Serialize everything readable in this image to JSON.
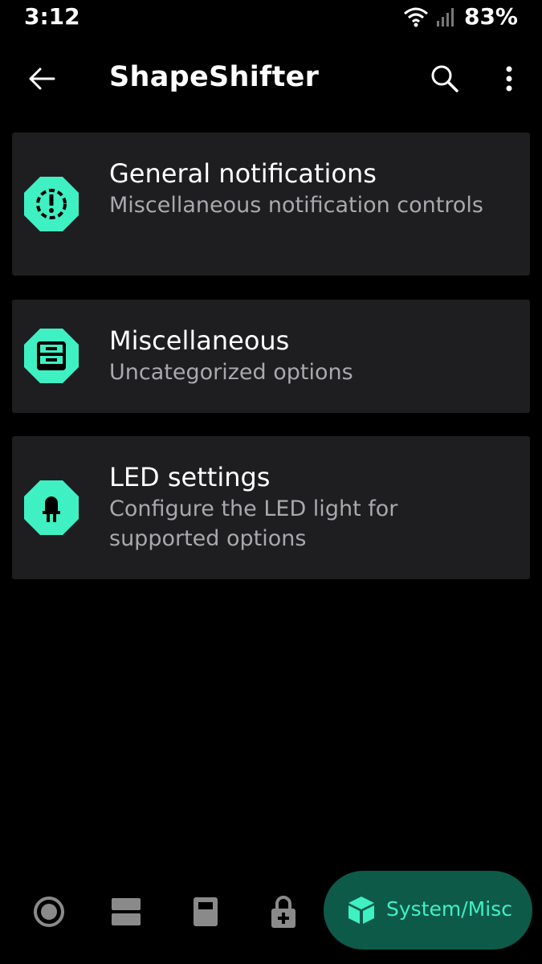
{
  "status_bar": {
    "time": "3:12",
    "battery": "83%",
    "icons": [
      "wifi-icon",
      "signal-icon"
    ]
  },
  "app_bar": {
    "title": "ShapeShifter",
    "icons": [
      "back-arrow-icon",
      "search-icon",
      "more-vert-icon"
    ]
  },
  "cards": [
    {
      "title": "General notifications",
      "subtitle": "Miscellaneous notification controls",
      "icon": "notification-alert-icon"
    },
    {
      "title": "Miscellaneous",
      "subtitle": "Uncategorized options",
      "icon": "inbox-tray-icon"
    },
    {
      "title": "LED settings",
      "subtitle": "Configure the LED light for supported options",
      "icon": "led-icon"
    }
  ],
  "bottom_nav": {
    "items": [
      {
        "icon": "radio-circle-icon"
      },
      {
        "icon": "split-panels-icon"
      },
      {
        "icon": "calculator-icon"
      },
      {
        "icon": "lock-add-icon"
      }
    ],
    "active": {
      "label": "System/Misc",
      "icon": "cube-icon"
    }
  },
  "colors": {
    "accent": "#3ff0c3",
    "card_bg": "#1e1e20",
    "active_pill_bg": "#0d5a48",
    "subtitle": "#a9a9ad"
  }
}
